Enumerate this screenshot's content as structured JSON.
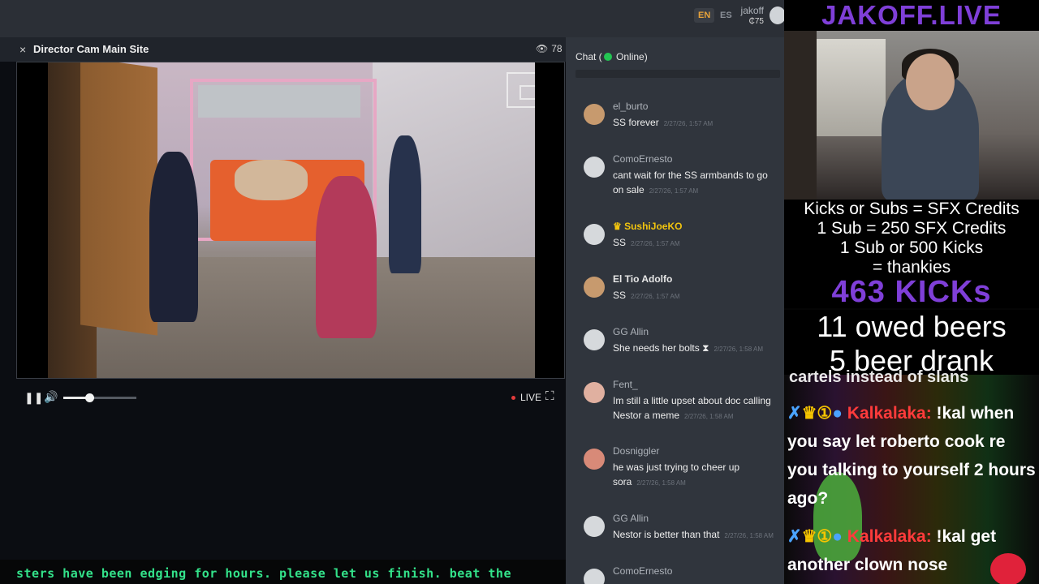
{
  "topbar": {
    "lang_en": "EN",
    "lang_es": "ES",
    "username": "jakoff",
    "credits": "₵75"
  },
  "player": {
    "close_glyph": "×",
    "title": "Director Cam Main Site",
    "viewer_count": "78",
    "live_label": "LIVE",
    "volume_level": 0.35
  },
  "ticker": {
    "text": "sters have been edging for hours. please let us finish. beat the"
  },
  "chat": {
    "title_prefix": "Chat (",
    "title_status": "Online)",
    "messages": [
      {
        "name": "el_burto",
        "text": "SS forever",
        "time": "2/27/26, 1:57 AM"
      },
      {
        "name": "ComoErnesto",
        "text": "cant wait for the SS armbands to go on sale",
        "time": "2/27/26, 1:57 AM"
      },
      {
        "name": "SushiJoeKO",
        "crown": "♛",
        "text": "SS",
        "time": "2/27/26, 1:57 AM"
      },
      {
        "name": "El Tio Adolfo",
        "text": "SS",
        "time": "2/27/26, 1:57 AM"
      },
      {
        "name": "GG Allin",
        "text": "She needs her bolts ⧗",
        "time": "2/27/26, 1:58 AM"
      },
      {
        "name": "Fent_",
        "text": "Im still a little upset about doc calling Nestor a meme",
        "time": "2/27/26, 1:58 AM"
      },
      {
        "name": "Dosniggler",
        "text": "he was just trying to cheer up sora",
        "time": "2/27/26, 1:58 AM"
      },
      {
        "name": "GG Allin",
        "text": "Nestor is better than that",
        "time": "2/27/26, 1:58 AM"
      },
      {
        "name": "ComoErnesto",
        "text": "",
        "time": ""
      }
    ]
  },
  "stream": {
    "brand": "JAKOFF.LIVE",
    "rules": [
      "Kicks or Subs = SFX Credits",
      "1 Sub = 250 SFX Credits",
      "1 Sub or 500 Kicks",
      "= thankies"
    ],
    "kicks": "463 KICKs",
    "beers_owed": "11 owed beers",
    "beers_drank": "5 beer drank",
    "kick_chat_cut": "cartels instead of slans",
    "kick_chat": [
      {
        "name": "Kalkalaka:",
        "text": "!kal when you say let roberto cook re you talking to yourself 2 hours ago?"
      },
      {
        "name": "Kalkalaka:",
        "text": "!kal get another clown nose"
      }
    ]
  }
}
